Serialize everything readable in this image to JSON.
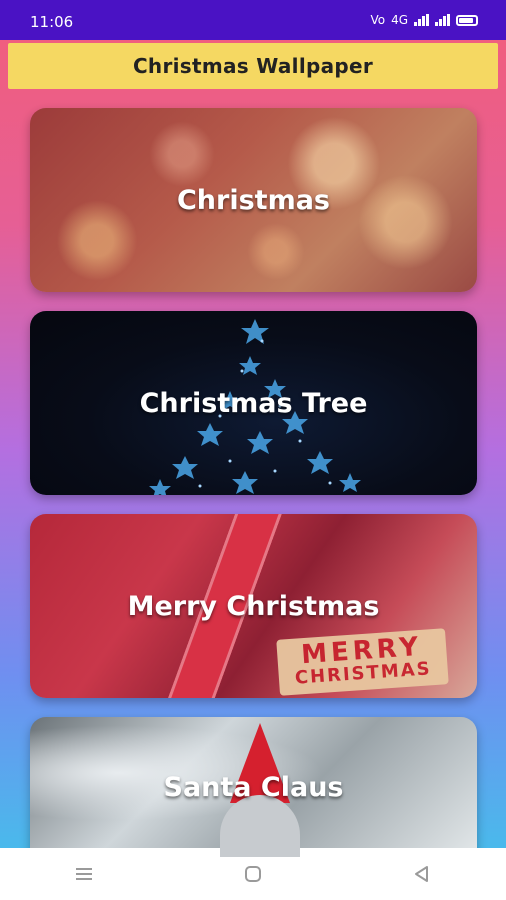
{
  "status_bar": {
    "time": "11:06",
    "volte": "Vo",
    "network": "4G"
  },
  "app_bar": {
    "title": "Christmas Wallpaper"
  },
  "categories": [
    {
      "label": "Christmas"
    },
    {
      "label": "Christmas Tree"
    },
    {
      "label": "Merry Christmas",
      "image_text_line1": "MERRY",
      "image_text_line2": "CHRISTMAS"
    },
    {
      "label": "Santa Claus"
    }
  ],
  "nav_bar": {
    "icons": [
      "menu-icon",
      "home-icon",
      "back-icon"
    ]
  },
  "colors": {
    "status_bar": "#4a12c4",
    "title_bar": "#f5d862",
    "gradient_top": "#f25e7a",
    "gradient_bottom": "#3fc6ea"
  }
}
